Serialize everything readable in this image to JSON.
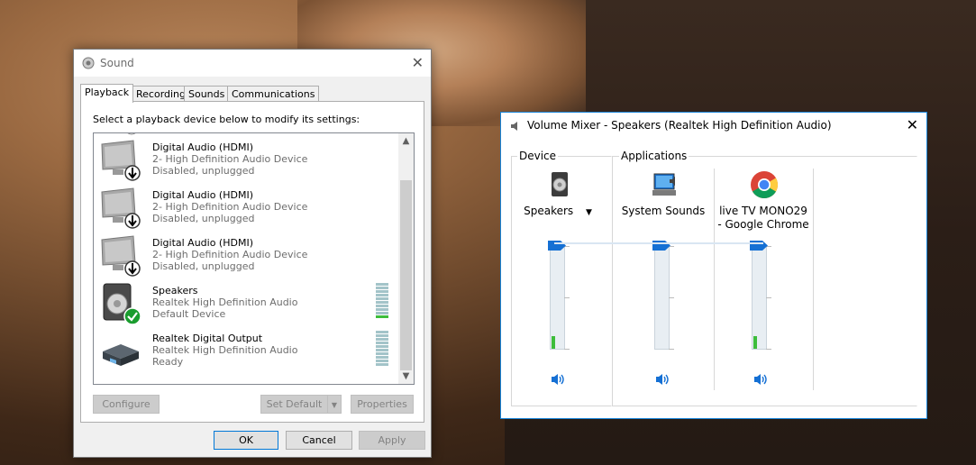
{
  "sound": {
    "title": "Sound",
    "tabs": [
      "Playback",
      "Recording",
      "Sounds",
      "Communications"
    ],
    "instructions": "Select a playback device below to modify its settings:",
    "devices": [
      {
        "name": "Digital Audio (HDMI)",
        "description": "2- High Definition Audio Device",
        "status": "Disabled, unplugged",
        "icon": "monitor-disabled-icon"
      },
      {
        "name": "Digital Audio (HDMI)",
        "description": "2- High Definition Audio Device",
        "status": "Disabled, unplugged",
        "icon": "monitor-disabled-icon"
      },
      {
        "name": "Digital Audio (HDMI)",
        "description": "2- High Definition Audio Device",
        "status": "Disabled, unplugged",
        "icon": "monitor-disabled-icon"
      },
      {
        "name": "Speakers",
        "description": "Realtek High Definition Audio",
        "status": "Default Device",
        "icon": "speaker-default-icon",
        "level": 0.1
      },
      {
        "name": "Realtek Digital Output",
        "description": "Realtek High Definition Audio",
        "status": "Ready",
        "icon": "digital-output-icon",
        "level": 0
      }
    ],
    "buttons": {
      "configure": "Configure",
      "set_default": "Set Default",
      "properties": "Properties",
      "ok": "OK",
      "cancel": "Cancel",
      "apply": "Apply"
    }
  },
  "mixer": {
    "title": "Volume Mixer - Speakers (Realtek High Definition Audio)",
    "device_group": "Device",
    "applications_group": "Applications",
    "channels": [
      {
        "name": "Speakers",
        "icon": "speaker-icon",
        "volume": 1.0,
        "peak": 0.12
      },
      {
        "name": "System Sounds",
        "icon": "system-sounds-icon",
        "volume": 1.0,
        "peak": 0
      },
      {
        "name": "live TV MONO29 - Google Chrome",
        "icon": "chrome-icon",
        "volume": 1.0,
        "peak": 0.12
      }
    ]
  },
  "colors": {
    "accent": "#1570d4",
    "meter_green": "#3dbd3b",
    "disabled_text": "#6d6d6d"
  }
}
